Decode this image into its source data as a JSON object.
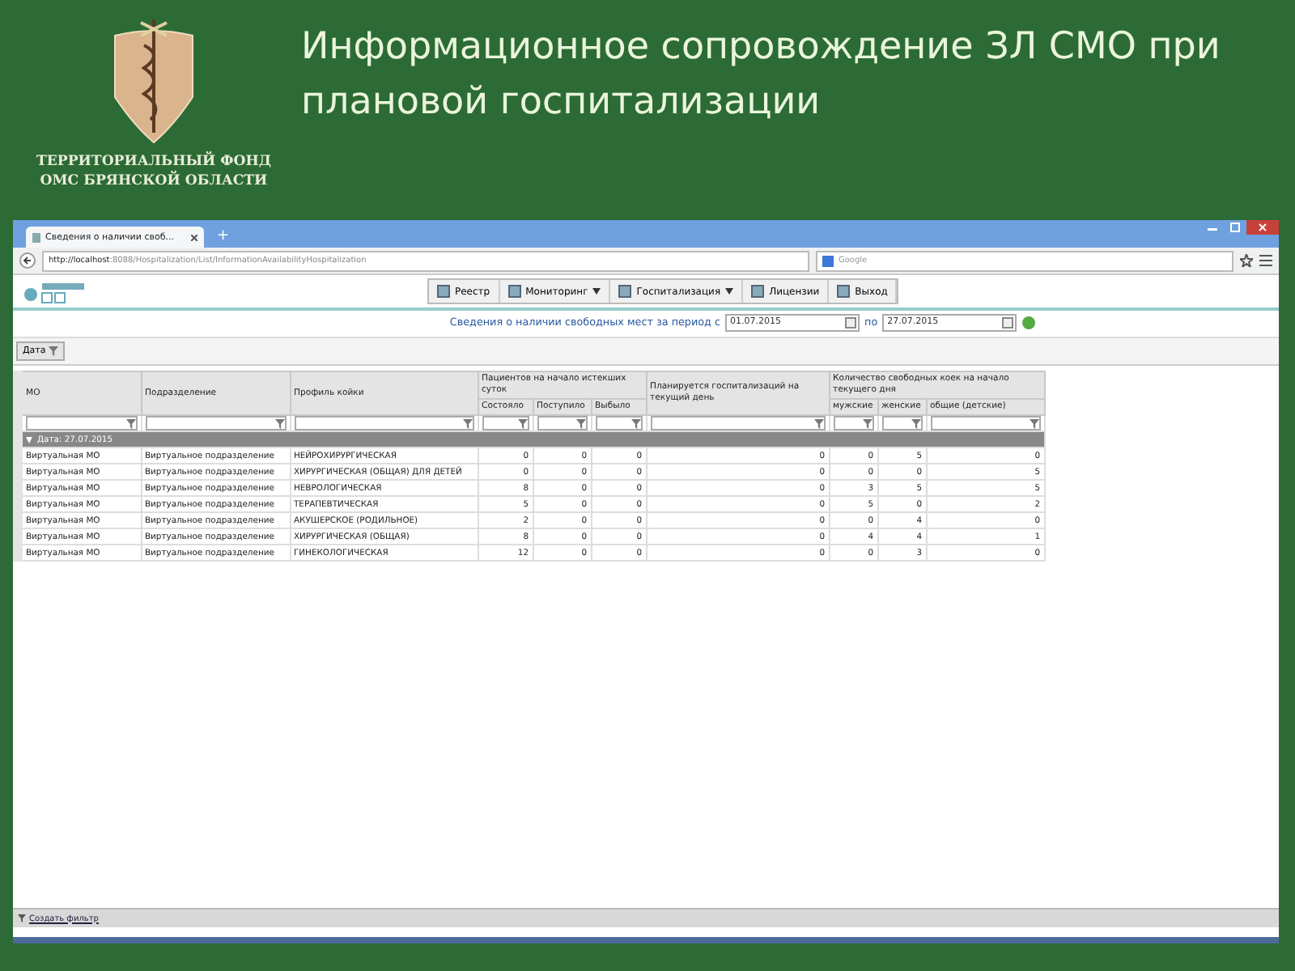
{
  "slide": {
    "org_name": [
      "ТЕРРИТОРИАЛЬНЫЙ ФОНД",
      "ОМС БРЯНСКОЙ ОБЛАСТИ"
    ],
    "title": "Информационное сопровождение ЗЛ СМО при плановой госпитализации"
  },
  "browser": {
    "tab_title": "Сведения о наличии своб...",
    "new_tab": "+",
    "url_host": "http://localhost",
    "url_path": ":8088/Hospitalization/List/InformationAvailabilityHospitalization",
    "search_placeholder": "Google"
  },
  "menu": [
    {
      "label": "Реестр",
      "dropdown": false
    },
    {
      "label": "Мониторинг",
      "dropdown": true
    },
    {
      "label": "Госпитализация",
      "dropdown": true
    },
    {
      "label": "Лицензии",
      "dropdown": false
    },
    {
      "label": "Выход",
      "dropdown": false
    }
  ],
  "period": {
    "label": "Сведения о наличии свободных мест за период с",
    "from": "01.07.2015",
    "to_label": "по",
    "to": "27.07.2015"
  },
  "group_button": "Дата",
  "table": {
    "column_groups": [
      {
        "label": "Пациентов на начало истекших суток"
      },
      {
        "label": "Количество свободных коек на начало текущего дня"
      }
    ],
    "columns": [
      {
        "label": "МО",
        "kind": "single"
      },
      {
        "label": "Подразделение",
        "kind": "single"
      },
      {
        "label": "Профиль койки",
        "kind": "single"
      },
      {
        "label": "Состояло",
        "kind": "grouped"
      },
      {
        "label": "Поступило",
        "kind": "grouped"
      },
      {
        "label": "Выбыло",
        "kind": "grouped"
      },
      {
        "label": "Планируется госпитализаций на текущий день",
        "kind": "single"
      },
      {
        "label": "мужские",
        "kind": "grouped"
      },
      {
        "label": "женские",
        "kind": "grouped"
      },
      {
        "label": "общие (детские)",
        "kind": "grouped"
      }
    ],
    "group_row": "Дата: 27.07.2015",
    "rows": [
      [
        "Виртуальная МО",
        "Виртуальное подразделение",
        "НЕЙРОХИРУРГИЧЕСКАЯ",
        "0",
        "0",
        "0",
        "0",
        "0",
        "5",
        "0"
      ],
      [
        "Виртуальная МО",
        "Виртуальное подразделение",
        "ХИРУРГИЧЕСКАЯ (ОБЩАЯ) ДЛЯ ДЕТЕЙ",
        "0",
        "0",
        "0",
        "0",
        "0",
        "0",
        "5"
      ],
      [
        "Виртуальная МО",
        "Виртуальное подразделение",
        "НЕВРОЛОГИЧЕСКАЯ",
        "8",
        "0",
        "0",
        "0",
        "3",
        "5",
        "5"
      ],
      [
        "Виртуальная МО",
        "Виртуальное подразделение",
        "ТЕРАПЕВТИЧЕСКАЯ",
        "5",
        "0",
        "0",
        "0",
        "5",
        "0",
        "2"
      ],
      [
        "Виртуальная МО",
        "Виртуальное подразделение",
        "АКУШЕРСКОЕ (РОДИЛЬНОЕ)",
        "2",
        "0",
        "0",
        "0",
        "0",
        "4",
        "0"
      ],
      [
        "Виртуальная МО",
        "Виртуальное подразделение",
        "ХИРУРГИЧЕСКАЯ (ОБЩАЯ)",
        "8",
        "0",
        "0",
        "0",
        "4",
        "4",
        "1"
      ],
      [
        "Виртуальная МО",
        "Виртуальное подразделение",
        "ГИНЕКОЛОГИЧЕСКАЯ",
        "12",
        "0",
        "0",
        "0",
        "0",
        "3",
        "0"
      ]
    ]
  },
  "footer_link": "Создать фильтр"
}
